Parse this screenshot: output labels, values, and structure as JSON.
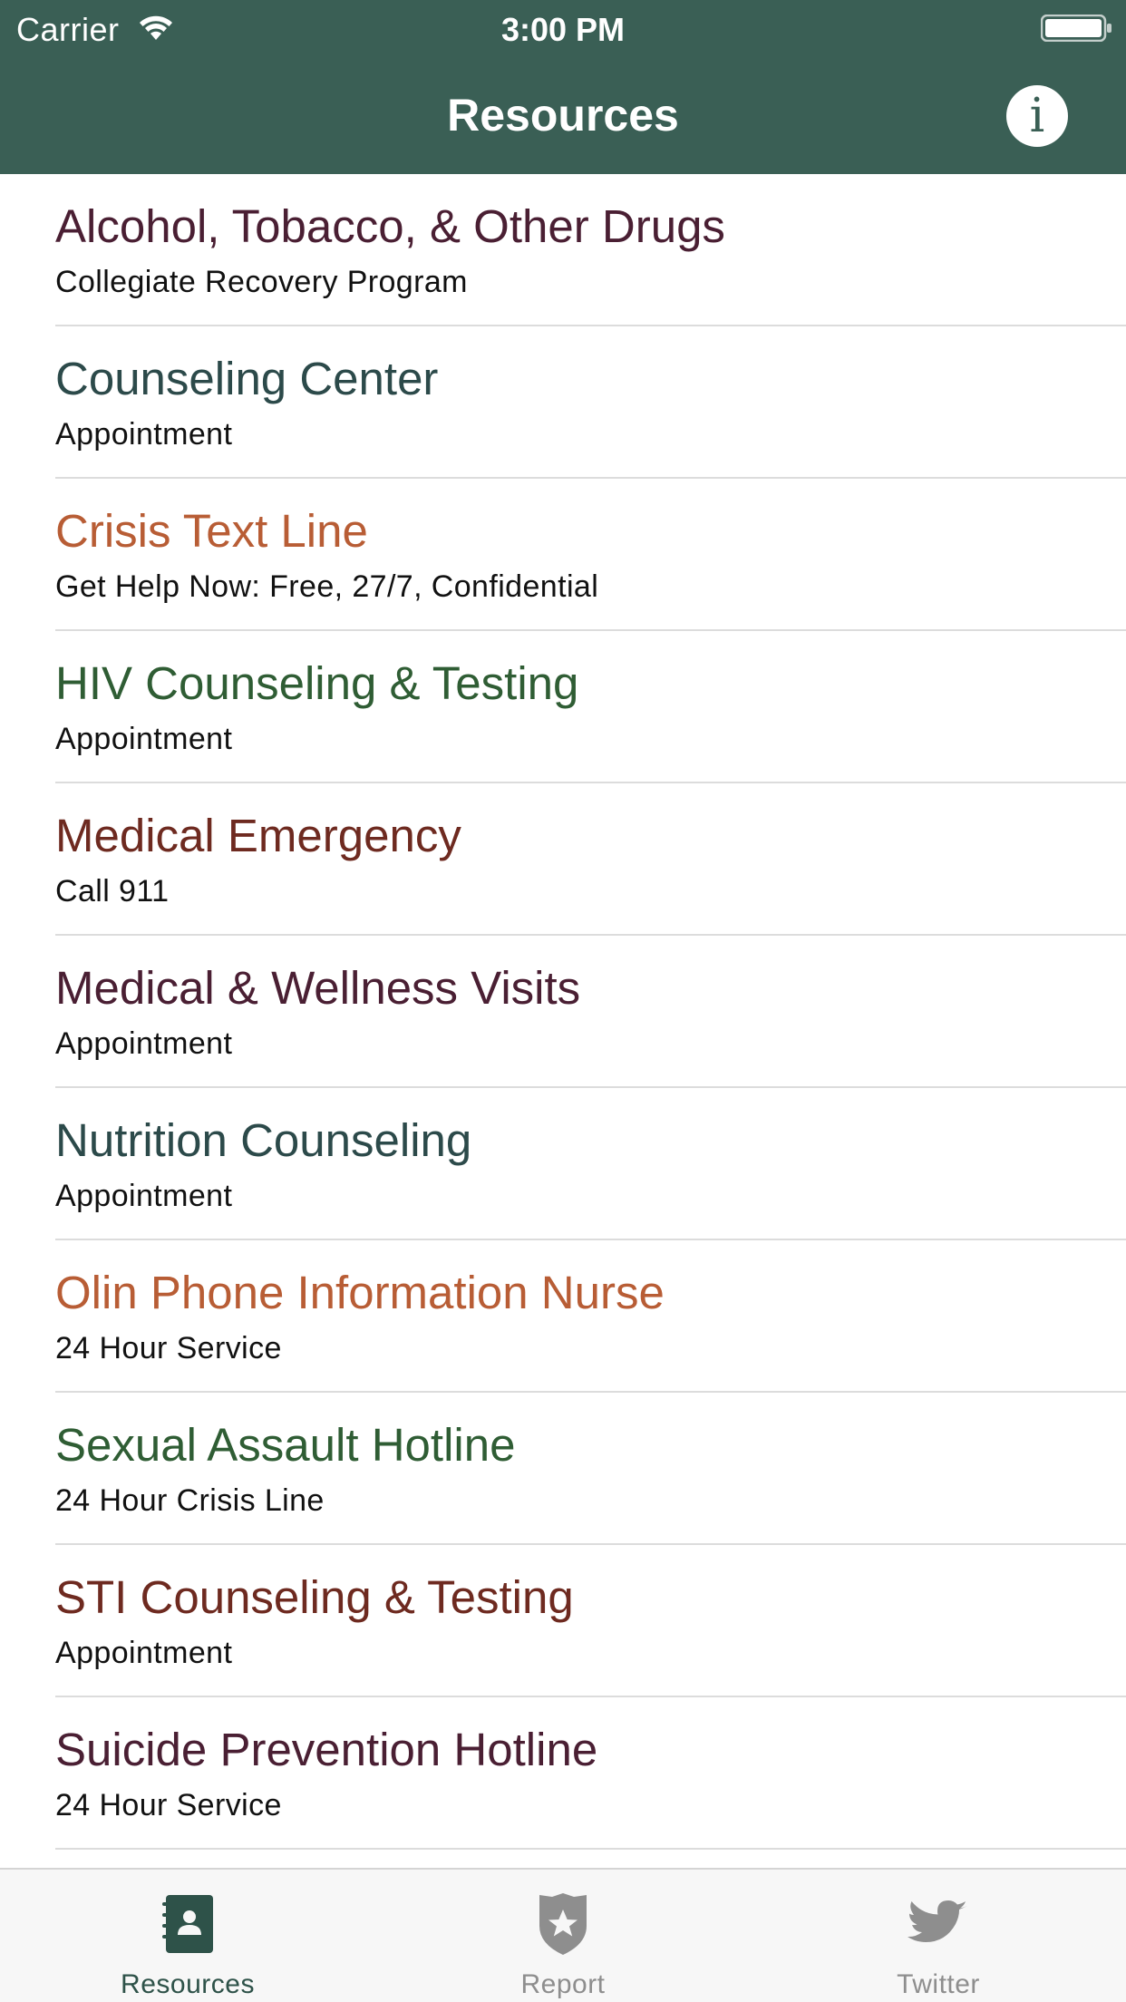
{
  "status_bar": {
    "carrier": "Carrier",
    "time": "3:00 PM"
  },
  "nav": {
    "title": "Resources",
    "info_label": "i"
  },
  "colors": {
    "nav_bg": "#3a5f55",
    "active_tab": "#2e5249",
    "inactive_tab": "#8e8e8e"
  },
  "resources": [
    {
      "title": "Alcohol, Tobacco, & Other Drugs",
      "subtitle": "Collegiate Recovery Program",
      "color": "#4a1f33"
    },
    {
      "title": "Counseling Center",
      "subtitle": "Appointment",
      "color": "#2c4a4a"
    },
    {
      "title": "Crisis Text Line",
      "subtitle": "Get Help Now: Free, 27/7, Confidential",
      "color": "#b85d35"
    },
    {
      "title": "HIV Counseling & Testing",
      "subtitle": "Appointment",
      "color": "#2f5d34"
    },
    {
      "title": "Medical Emergency",
      "subtitle": "Call 911",
      "color": "#6e2a20"
    },
    {
      "title": "Medical & Wellness Visits",
      "subtitle": "Appointment",
      "color": "#4a1f33"
    },
    {
      "title": "Nutrition Counseling",
      "subtitle": "Appointment",
      "color": "#2c4a4a"
    },
    {
      "title": "Olin Phone Information Nurse",
      "subtitle": "24 Hour Service",
      "color": "#b85d35"
    },
    {
      "title": "Sexual Assault Hotline",
      "subtitle": "24 Hour Crisis Line",
      "color": "#2f5d34"
    },
    {
      "title": "STI Counseling & Testing",
      "subtitle": "Appointment",
      "color": "#6e2a20"
    },
    {
      "title": "Suicide Prevention Hotline",
      "subtitle": "24 Hour Service",
      "color": "#4a1f33"
    }
  ],
  "tabs": [
    {
      "label": "Resources",
      "icon": "contact-book-icon",
      "active": true
    },
    {
      "label": "Report",
      "icon": "police-badge-icon",
      "active": false
    },
    {
      "label": "Twitter",
      "icon": "twitter-bird-icon",
      "active": false
    }
  ]
}
